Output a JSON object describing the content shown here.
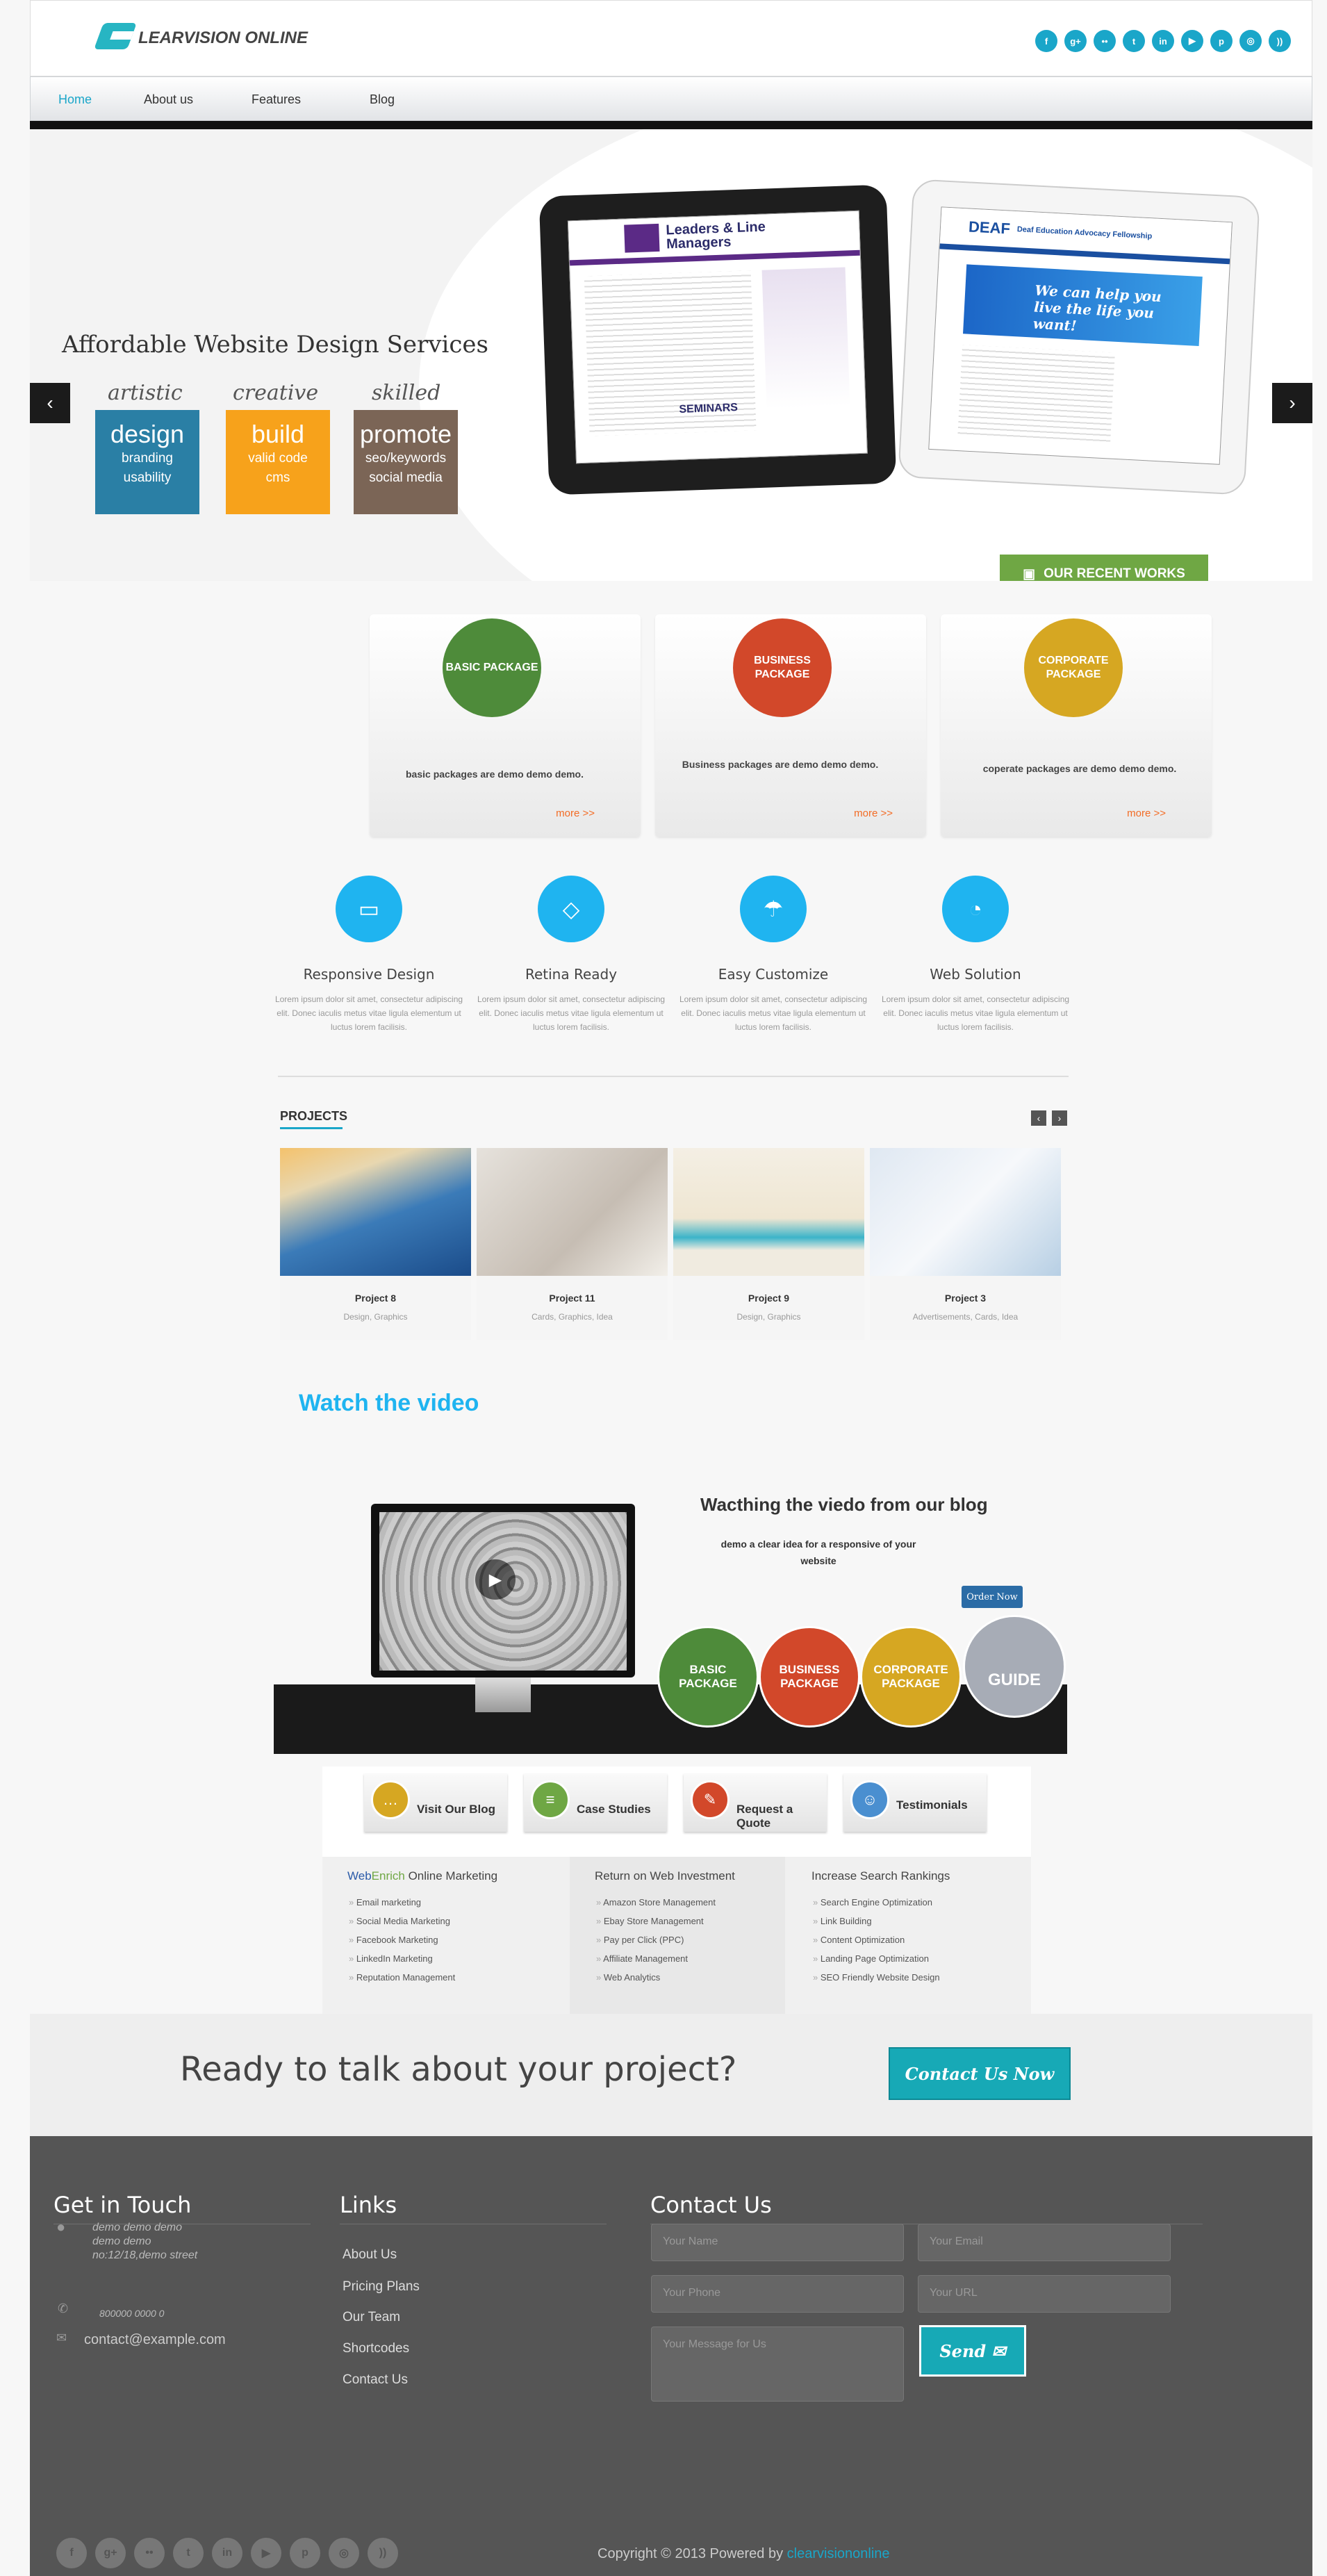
{
  "header": {
    "logo_text": "LEARVISION ONLINE",
    "social_icons": [
      "facebook-icon",
      "google-plus-icon",
      "flickr-icon",
      "twitter-icon",
      "linkedin-icon",
      "youtube-icon",
      "pinterest-icon",
      "dribbble-icon",
      "rss-icon"
    ],
    "social_glyphs": [
      "f",
      "g+",
      "••",
      "t",
      "in",
      "▶",
      "p",
      "◎",
      "))"
    ]
  },
  "nav": {
    "items": [
      "Home",
      "About us",
      "Features",
      "Blog"
    ],
    "active": "Home",
    "active_color": "#1aa6c9"
  },
  "hero": {
    "title": "Affordable Website Design Services",
    "words": [
      "artistic",
      "creative",
      "skilled"
    ],
    "boxes": [
      {
        "title": "design",
        "lines": [
          "branding",
          "usability"
        ],
        "color": "#2a7fa5"
      },
      {
        "title": "build",
        "lines": [
          "valid code",
          "cms"
        ],
        "color": "#f7a21b"
      },
      {
        "title": "promote",
        "lines": [
          "seo/keywords",
          "social media"
        ],
        "color": "#7b6556"
      }
    ],
    "prev": "‹",
    "next": "›",
    "tablet1": {
      "heading": "Leaders & Line Managers",
      "sub": "SEMINARS"
    },
    "tablet2": {
      "heading": "DEAF",
      "tagline": "We can help you live the life you want!",
      "sub": "Deaf Education Advocacy Fellowship"
    },
    "recent_works": "OUR RECENT WORKS"
  },
  "packages": [
    {
      "name": "BASIC PACKAGE",
      "desc": "basic packages are demo demo demo.",
      "more": "more >>",
      "color": "#4e8b3a"
    },
    {
      "name": "BUSINESS PACKAGE",
      "desc": "Business packages are demo demo demo.",
      "more": "more >>",
      "color": "#d2482a"
    },
    {
      "name": "CORPORATE PACKAGE",
      "desc": "coperate packages are demo demo demo.",
      "more": "more >>",
      "color": "#d6a722"
    }
  ],
  "features": [
    {
      "title": "Responsive Design",
      "icon": "monitor-icon",
      "glyph": "▭",
      "text": "Lorem ipsum dolor sit amet, consectetur adipiscing elit. Donec iaculis metus vitae ligula elementum ut luctus lorem facilisis."
    },
    {
      "title": "Retina Ready",
      "icon": "diamond-icon",
      "glyph": "◇",
      "text": "Lorem ipsum dolor sit amet, consectetur adipiscing elit. Donec iaculis metus vitae ligula elementum ut luctus lorem facilisis."
    },
    {
      "title": "Easy Customize",
      "icon": "umbrella-icon",
      "glyph": "☂",
      "text": "Lorem ipsum dolor sit amet, consectetur adipiscing elit. Donec iaculis metus vitae ligula elementum ut luctus lorem facilisis."
    },
    {
      "title": "Web Solution",
      "icon": "satellite-icon",
      "glyph": "◔",
      "text": "Lorem ipsum dolor sit amet, consectetur adipiscing elit. Donec iaculis metus vitae ligula elementum ut luctus lorem facilisis."
    }
  ],
  "projects": {
    "heading": "PROJECTS",
    "prev": "‹",
    "next": "›",
    "items": [
      {
        "title": "Project 8",
        "tags": "Design, Graphics"
      },
      {
        "title": "Project 11",
        "tags": "Cards, Graphics, Idea"
      },
      {
        "title": "Project 9",
        "tags": "Design, Graphics"
      },
      {
        "title": "Project 3",
        "tags": "Advertisements, Cards, Idea"
      }
    ]
  },
  "video": {
    "heading": "Watch the video",
    "title": "Wacthing the viedo from our blog",
    "sub": "demo a clear idea for a responsive of your website",
    "order": "Order Now",
    "play": "▶",
    "circles": [
      {
        "label": "BASIC PACKAGE",
        "color": "#4e8b3a"
      },
      {
        "label": "BUSINESS PACKAGE",
        "color": "#d2482a"
      },
      {
        "label": "CORPORATE PACKAGE",
        "color": "#d6a722"
      },
      {
        "label": "GUIDE",
        "color": "#a7acb6"
      }
    ]
  },
  "tabs": [
    {
      "label": "Visit Our Blog",
      "color": "#d6a722",
      "icon": "chat-icon",
      "glyph": "…"
    },
    {
      "label": "Case Studies",
      "color": "#6fa744",
      "icon": "document-icon",
      "glyph": "≡"
    },
    {
      "label": "Request a Quote",
      "color": "#d2482a",
      "icon": "edit-icon",
      "glyph": "✎"
    },
    {
      "label": "Testimonials",
      "color": "#4a8fd0",
      "icon": "users-icon",
      "glyph": "☺"
    }
  ],
  "columns": [
    {
      "title_a": "Web",
      "title_b": "Enrich",
      "title_c": " Online Marketing",
      "items": [
        "Email marketing",
        "Social Media Marketing",
        "Facebook Marketing",
        "LinkedIn Marketing",
        "Reputation Management"
      ]
    },
    {
      "title": "Return on Web Investment",
      "items": [
        "Amazon Store Management",
        "Ebay Store Management",
        "Pay per Click (PPC)",
        "Affiliate Management",
        "Web Analytics"
      ]
    },
    {
      "title": "Increase Search Rankings",
      "items": [
        "Search Engine Optimization",
        "Link Building",
        "Content Optimization",
        "Landing Page Optimization",
        "SEO Friendly Website Design"
      ]
    }
  ],
  "cta": {
    "text": "Ready to talk about your project?",
    "button": "Contact Us Now"
  },
  "footer": {
    "get_in_touch": "Get in Touch",
    "address_lines": [
      "demo demo demo",
      "demo demo",
      "no:12/18,demo street"
    ],
    "phone": "800000 0000 0",
    "email": "contact@example.com",
    "links_heading": "Links",
    "links": [
      "About Us",
      "Pricing Plans",
      "Our Team",
      "Shortcodes",
      "Contact Us"
    ],
    "contact_heading": "Contact Us",
    "placeholders": {
      "name": "Your Name",
      "email": "Your Email",
      "phone": "Your Phone",
      "url": "Your URL",
      "message": "Your Message for Us"
    },
    "send": "Send ✉",
    "copyright": "Copyright © 2013   Powered by ",
    "powered_link": "clearvisiononline",
    "social_glyphs": [
      "f",
      "g+",
      "••",
      "t",
      "in",
      "▶",
      "p",
      "◎",
      "))"
    ]
  }
}
